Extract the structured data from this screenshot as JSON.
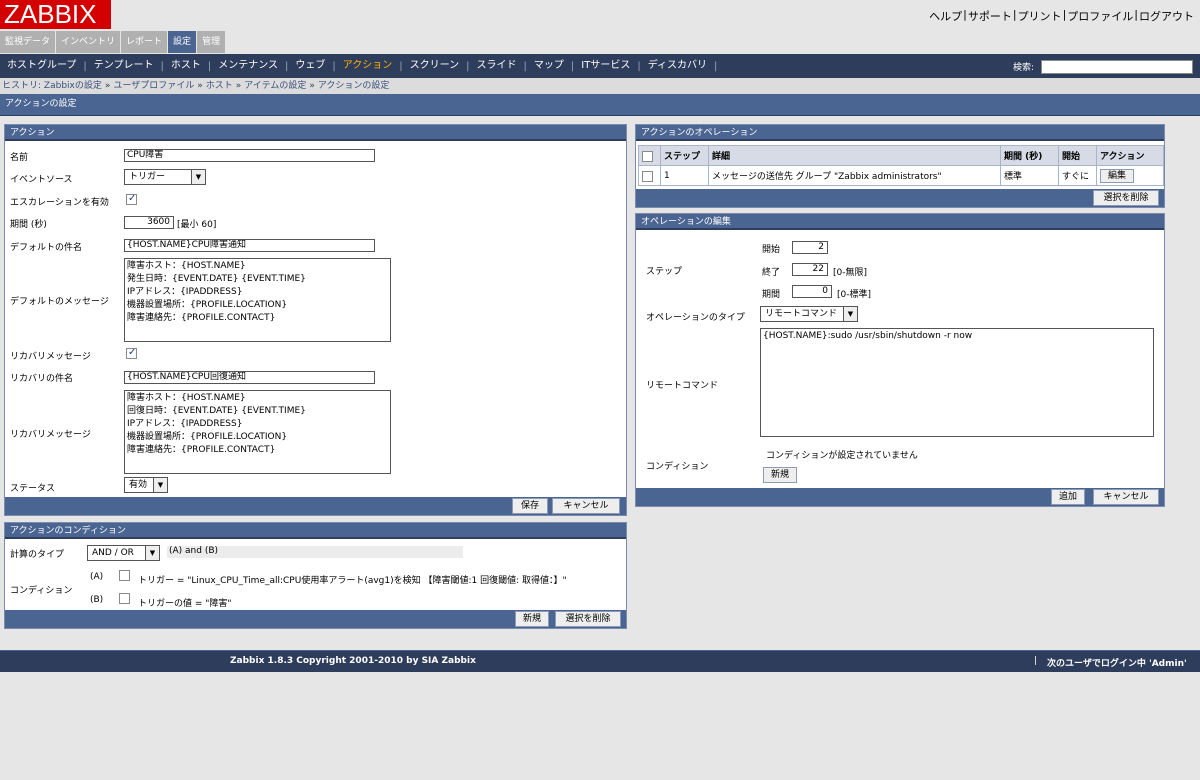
{
  "header": {
    "logo": "ZABBIX",
    "links": [
      "ヘルプ",
      "サポート",
      "プリント",
      "プロファイル",
      "ログアウト"
    ]
  },
  "main_menu": [
    "監視データ",
    "インベントリ",
    "レポート",
    "設定",
    "管理"
  ],
  "sub_menu": [
    "ホストグループ",
    "テンプレート",
    "ホスト",
    "メンテナンス",
    "ウェブ",
    "アクション",
    "スクリーン",
    "スライド",
    "マップ",
    "ITサービス",
    "ディスカバリ"
  ],
  "search": {
    "label": "検索:",
    "value": ""
  },
  "history": {
    "label": "ヒストリ:",
    "items": [
      "Zabbixの設定",
      "ユーザプロファイル",
      "ホスト",
      "アイテムの設定",
      "アクションの設定"
    ]
  },
  "page_title": "アクションの設定",
  "action": {
    "title": "アクション",
    "name_label": "名前",
    "name_value": "CPU障害",
    "event_source_label": "イベントソース",
    "event_source_value": "トリガー",
    "escalation_label": "エスカレーションを有効",
    "period_label": "期間 (秒)",
    "period_value": "3600",
    "period_note": "[最小 60]",
    "def_subject_label": "デフォルトの件名",
    "def_subject_value": "{HOST.NAME}CPU障害通知",
    "def_message_label": "デフォルトのメッセージ",
    "def_message_value": "障害ホスト：{HOST.NAME}\n発生日時：{EVENT.DATE} {EVENT.TIME}\nIPアドレス：{IPADDRESS}\n機器設置場所：{PROFILE.LOCATION}\n障害連絡先：{PROFILE.CONTACT}",
    "recovery_msg_label": "リカバリメッセージ",
    "recovery_subject_label": "リカバリの件名",
    "recovery_subject_value": "{HOST.NAME}CPU回復通知",
    "recovery_message_label": "リカバリメッセージ",
    "recovery_message_value": "障害ホスト：{HOST.NAME}\n回復日時：{EVENT.DATE} {EVENT.TIME}\nIPアドレス：{IPADDRESS}\n機器設置場所：{PROFILE.LOCATION}\n障害連絡先：{PROFILE.CONTACT}",
    "status_label": "ステータス",
    "status_value": "有効",
    "save_button": "保存",
    "cancel_button": "キャンセル"
  },
  "conditions": {
    "title": "アクションのコンディション",
    "calc_label": "計算のタイプ",
    "calc_value": "AND / OR",
    "calc_formula": "(A) and (B)",
    "condition_label": "コンディション",
    "a_tag": "(A)",
    "a_text": "トリガー = \"Linux_CPU_Time_all:CPU使用率アラート(avg1)を検知 【障害閾値:1 回復閾値: 取得値：】\"",
    "b_tag": "(B)",
    "b_text": "トリガーの値 = \"障害\"",
    "new_button": "新規",
    "delete_button": "選択を削除"
  },
  "operations": {
    "title": "アクションのオペレーション",
    "headers": [
      "ステップ",
      "詳細",
      "期間 (秒)",
      "開始",
      "アクション"
    ],
    "row": {
      "step": "1",
      "detail": "メッセージの送信先 グループ \"Zabbix administrators\"",
      "period": "標準",
      "start": "すぐに",
      "action": "編集"
    },
    "delete_button": "選択を削除"
  },
  "op_edit": {
    "title": "オペレーションの編集",
    "step_label": "ステップ",
    "start_label": "開始",
    "start_value": "2",
    "end_label": "終了",
    "end_value": "22",
    "end_note": "[0-無限]",
    "period_label": "期間",
    "period_value": "0",
    "period_note": "[0-標準]",
    "type_label": "オペレーションのタイプ",
    "type_value": "リモートコマンド",
    "remote_label": "リモートコマンド",
    "remote_value": "{HOST.NAME}:sudo /usr/sbin/shutdown -r now",
    "condition_label": "コンディション",
    "no_condition": "コンディションが設定されていません",
    "new_button": "新規",
    "add_button": "追加",
    "cancel_button": "キャンセル"
  },
  "footer": {
    "copyright": "Zabbix 1.8.3 Copyright 2001-2010 by SIA Zabbix",
    "login": "次のユーザでログイン中 'Admin'"
  }
}
